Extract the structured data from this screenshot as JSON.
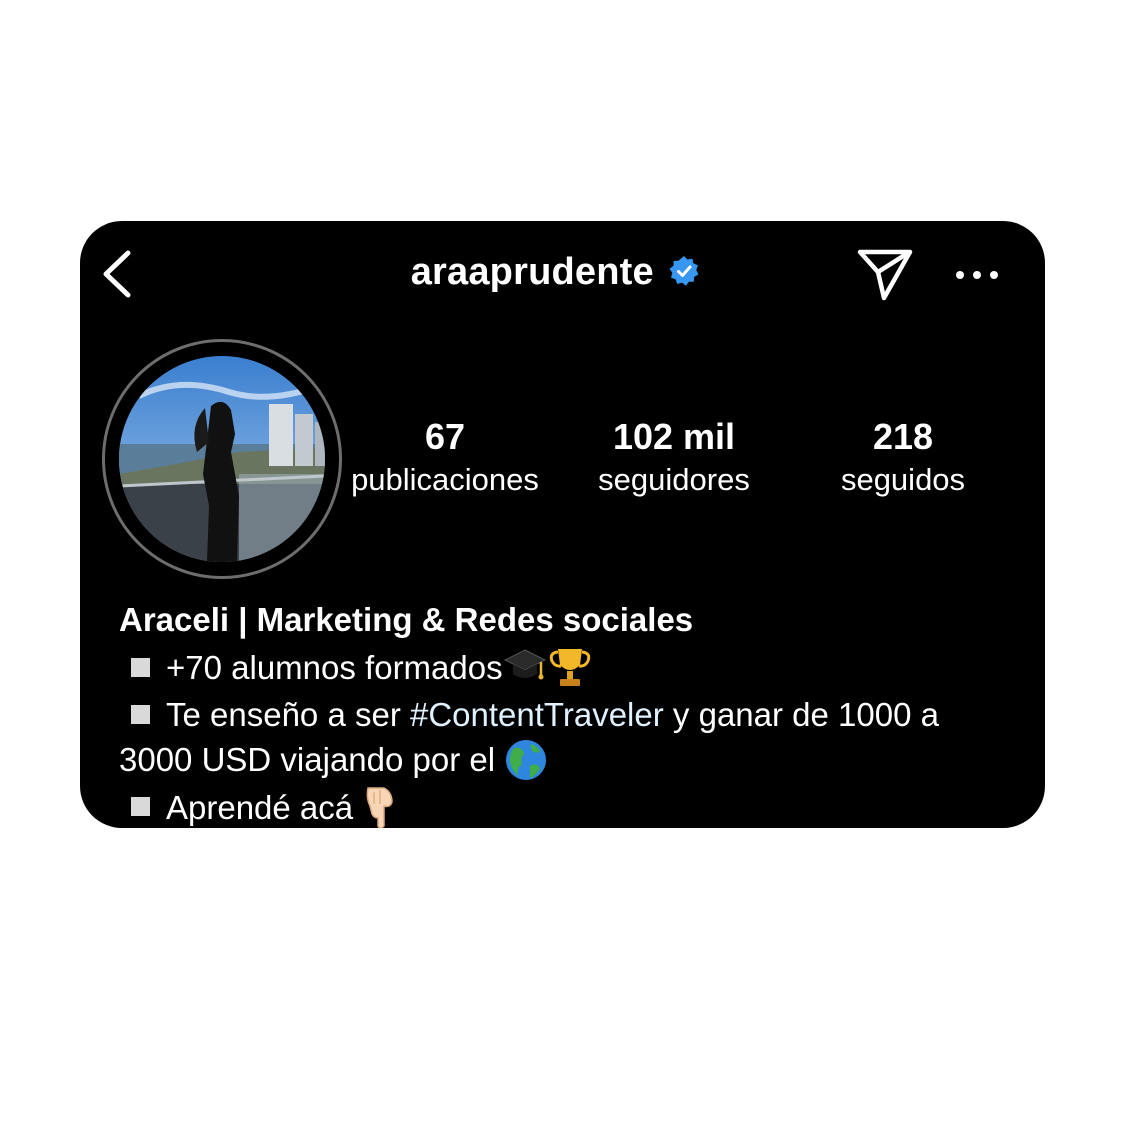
{
  "header": {
    "username": "araaprudente"
  },
  "stats": [
    {
      "value": "67",
      "label": "publicaciones"
    },
    {
      "value": "102 mil",
      "label": "seguidores"
    },
    {
      "value": "218",
      "label": "seguidos"
    }
  ],
  "bio": {
    "name": "Araceli | Marketing & Redes sociales",
    "line1": "+70 alumnos formados",
    "line2_pre": "Te enseño a ser ",
    "line2_hashtag": "#ContentTraveler",
    "line2_post": " y ganar de 1000 a",
    "line3": "3000 USD viajando por el ",
    "line4": "Aprendé acá "
  },
  "colors": {
    "background": "#000000",
    "verified": "#3897f0",
    "hashtag": "#e0f1ff"
  },
  "icons": [
    "back-chevron-icon",
    "verified-badge-icon",
    "send-icon",
    "more-icon",
    "graduation-cap-emoji",
    "trophy-emoji",
    "globe-emoji",
    "pointing-down-emoji"
  ]
}
